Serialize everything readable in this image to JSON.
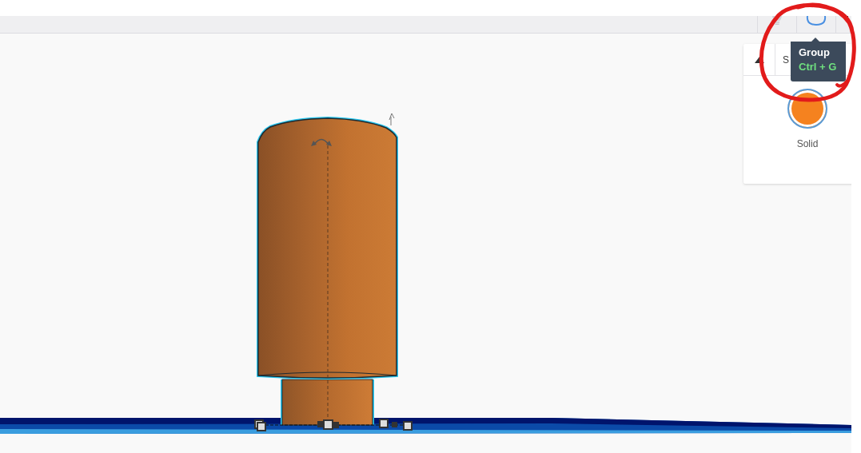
{
  "inspector": {
    "title": "S",
    "modes": [
      {
        "label": "Solid",
        "color": "#f5821f",
        "selected": true
      }
    ]
  },
  "tooltip": {
    "title": "Group",
    "shortcut": "Ctrl + G"
  }
}
